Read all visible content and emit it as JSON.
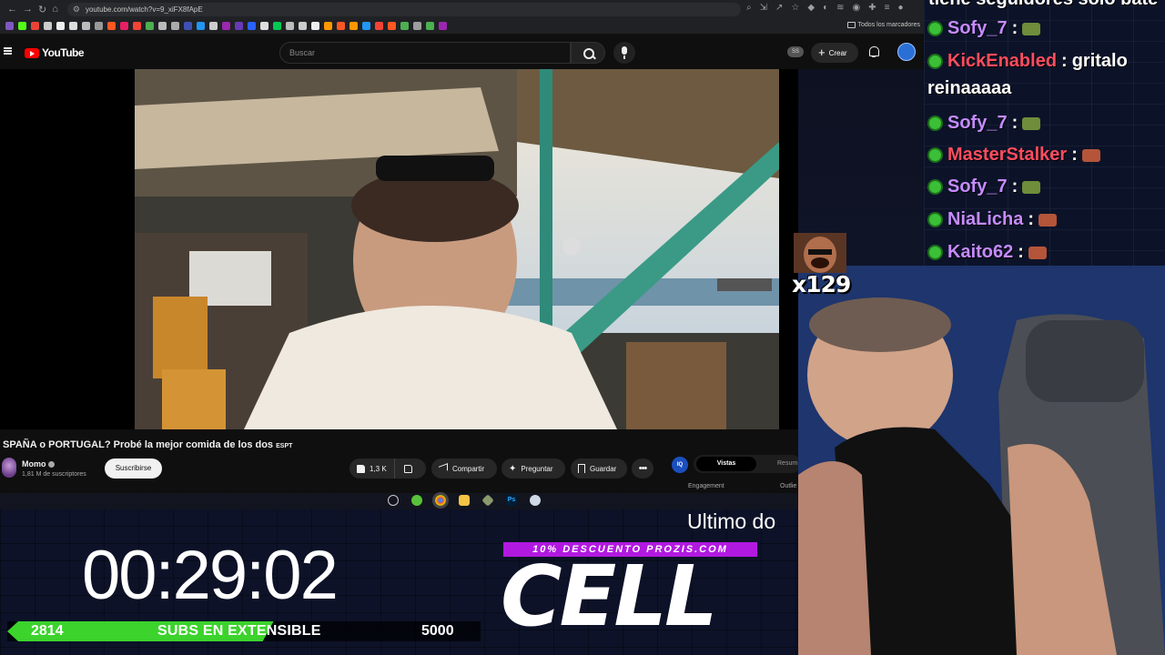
{
  "browser": {
    "url": "youtube.com/watch?v=9_xiFX8fApE",
    "bookmarks_folder": "Todos los marcadores"
  },
  "youtube": {
    "logo_text": "YouTube",
    "search_placeholder": "Buscar",
    "ss_badge": "SS",
    "create_label": "Crear"
  },
  "video": {
    "title": "SPAÑA o PORTUGAL? Probé la mejor comida de los dos",
    "title_suffix": "ESPT",
    "channel_name": "Momo",
    "channel_subs": "1,81 M de suscriptores",
    "subscribe_label": "Suscribirse",
    "likes": "1,3 K",
    "share_label": "Compartir",
    "ask_label": "Preguntar",
    "save_label": "Guardar",
    "more_label": "•••"
  },
  "side_panel": {
    "iq_label": "IQ",
    "tab_active": "Vistas",
    "tab_other": "Resum",
    "engagement_label": "Engagement",
    "outliers_label": "Outlie"
  },
  "stream_overlay": {
    "timer": "00:29:02",
    "subs_current": "2814",
    "subs_label": "SUBS EN EXTENSIBLE",
    "subs_goal": "5000",
    "subs_progress_fraction": 0.5628,
    "ticker_text": "Ultimo do",
    "promo_text": "10% DESCUENTO PROZIS.COM",
    "sponsor_text": "CELL",
    "emote_count": "x129"
  },
  "chat": {
    "truncated_top": "tiene seguidores solo bate",
    "messages": [
      {
        "user": "Sofy_7",
        "color": "#c58bff",
        "text": "",
        "emote": "snail"
      },
      {
        "user": "KickEnabled",
        "color": "#ff4d5e",
        "text": "gritalo"
      },
      {
        "user": "Sofy_7",
        "color": "#c58bff",
        "text": "",
        "emote": "snail"
      },
      {
        "user": "MasterStalker",
        "color": "#ff4d5e",
        "text": "",
        "emote": "face"
      },
      {
        "user": "Sofy_7",
        "color": "#c58bff",
        "text": "",
        "emote": "snail"
      },
      {
        "user": "NiaLicha",
        "color": "#c58bff",
        "text": "",
        "emote": "face"
      },
      {
        "user": "Kaito62",
        "color": "#c58bff",
        "text": "",
        "emote": "face"
      }
    ],
    "continuation": "reinaaaaa"
  },
  "colors": {
    "yt_red": "#ff0000",
    "subs_green": "#3bd32c",
    "promo_purple": "#b219e0",
    "chat_badge_green": "#3bbf37"
  }
}
